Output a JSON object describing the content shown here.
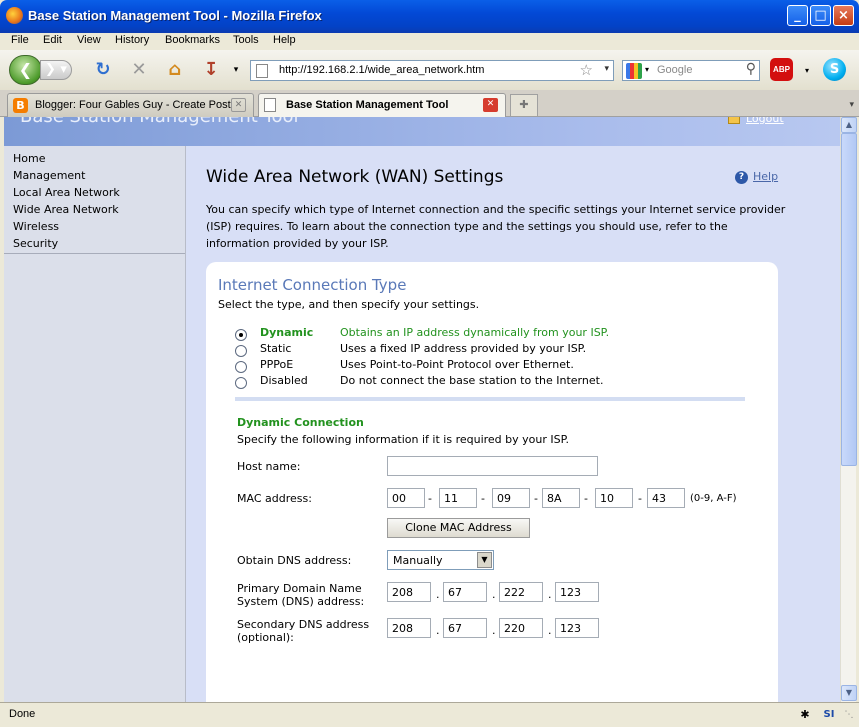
{
  "window": {
    "title": "Base Station Management Tool - Mozilla Firefox",
    "controls": [
      "_",
      "□",
      "×"
    ]
  },
  "menu": [
    "File",
    "Edit",
    "View",
    "History",
    "Bookmarks",
    "Tools",
    "Help"
  ],
  "navbar": {
    "url": "http://192.168.2.1/wide_area_network.htm",
    "search_placeholder": "Google",
    "abp_label": "ABP",
    "skype_label": "S"
  },
  "tabs": [
    {
      "label": "Blogger: Four Gables Guy - Create Post",
      "active": false
    },
    {
      "label": "Base Station Management Tool",
      "active": true
    }
  ],
  "page": {
    "app_title": "Base Station Management Tool",
    "logout": "Logout",
    "sidebar": [
      "Home",
      "Management",
      "Local Area Network",
      "Wide Area Network",
      "Wireless",
      "Security"
    ],
    "heading": "Wide Area Network (WAN) Settings",
    "help": "Help",
    "intro": "You can specify which type of Internet connection and the specific settings your Internet service provider (ISP) requires. To learn about the connection type and the settings you should use, refer to the information provided by your ISP.",
    "panel_title": "Internet Connection Type",
    "panel_sub": "Select the type, and then specify your settings.",
    "options": [
      {
        "label": "Dynamic",
        "desc": "Obtains an IP address dynamically from your ISP.",
        "selected": true
      },
      {
        "label": "Static",
        "desc": "Uses a fixed IP address provided by your ISP.",
        "selected": false
      },
      {
        "label": "PPPoE",
        "desc": "Uses Point-to-Point Protocol over Ethernet.",
        "selected": false
      },
      {
        "label": "Disabled",
        "desc": "Do not connect the base station to the Internet.",
        "selected": false
      }
    ],
    "dynamic": {
      "title": "Dynamic Connection",
      "sub": "Specify the following information if it is required by your ISP.",
      "host_label": "Host name:",
      "host_value": "",
      "mac_label": "MAC address:",
      "mac": [
        "00",
        "11",
        "09",
        "8A",
        "10",
        "43"
      ],
      "mac_hint": "(0-9, A-F)",
      "clone_button": "Clone MAC Address",
      "dns_label": "Obtain DNS address:",
      "dns_mode": "Manually",
      "primary_dns_label_1": "Primary Domain Name",
      "primary_dns_label_2": "System (DNS) address:",
      "primary_dns": [
        "208",
        "67",
        "222",
        "123"
      ],
      "secondary_dns_label_1": "Secondary DNS address",
      "secondary_dns_label_2": "(optional):",
      "secondary_dns": [
        "208",
        "67",
        "220",
        "123"
      ]
    }
  },
  "status": "Done"
}
